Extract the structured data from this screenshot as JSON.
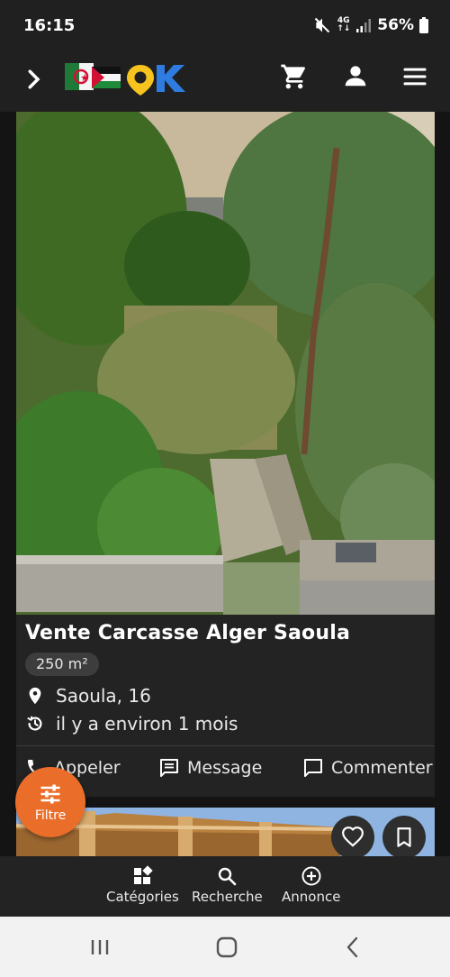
{
  "status": {
    "time": "16:15",
    "network": [
      "4G",
      "↑↓"
    ],
    "battery": "56%"
  },
  "appbar": {
    "logo_text": "OK",
    "icons": [
      "chevron-right-icon",
      "cart-icon",
      "user-icon",
      "menu-icon"
    ]
  },
  "listing": {
    "title": "Vente Carcasse Alger Saoula",
    "area": "250 m²",
    "location": "Saoula, 16",
    "time_ago": "il y a environ 1 mois",
    "actions": {
      "call": "Appeler",
      "message": "Message",
      "comment": "Commenter"
    }
  },
  "filter": {
    "label": "Filtre"
  },
  "bottom_nav": {
    "categories": "Catégories",
    "search": "Recherche",
    "post": "Annonce"
  },
  "colors": {
    "accent": "#ea6e2a",
    "logo_yellow": "#f7c31e",
    "logo_blue": "#2f7ce0"
  }
}
